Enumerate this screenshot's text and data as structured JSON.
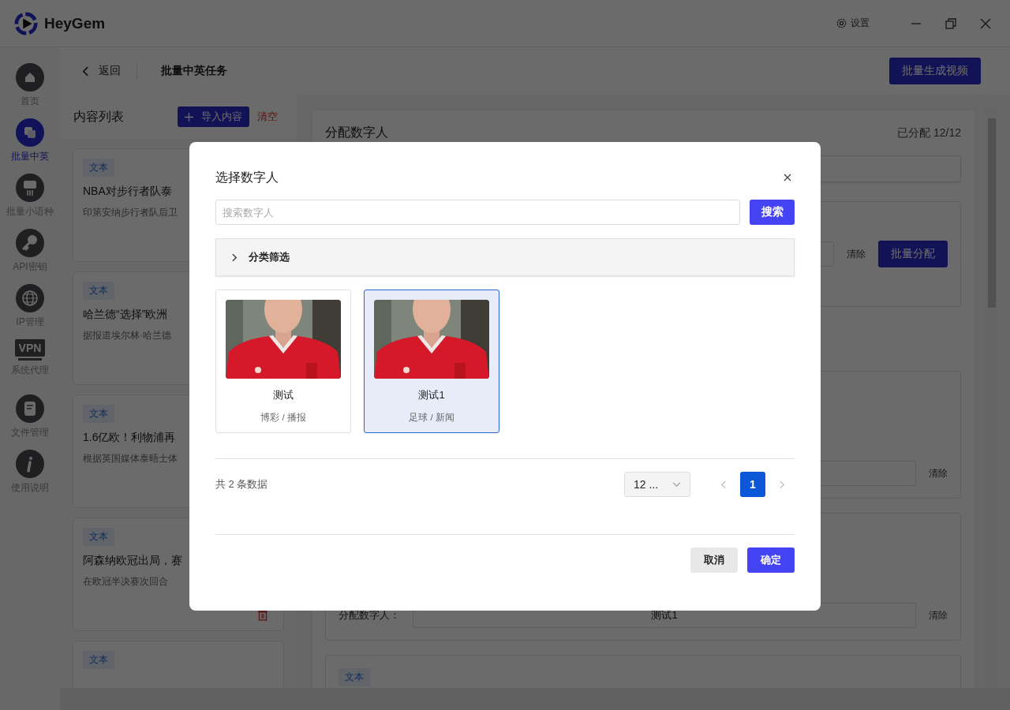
{
  "app": {
    "name": "HeyGem",
    "settings_label": "设置"
  },
  "sidebar": [
    {
      "label": "首页",
      "kind": "home",
      "selected": false
    },
    {
      "label": "批量中英",
      "kind": "layers",
      "selected": true
    },
    {
      "label": "批量小语种",
      "kind": "board",
      "selected": false
    },
    {
      "label": "API密钥",
      "kind": "key",
      "selected": false
    },
    {
      "label": "IP管理",
      "kind": "globe",
      "selected": false
    },
    {
      "label": "系统代理",
      "kind": "vpn",
      "badge": "VPN",
      "selected": false
    },
    {
      "label": "文件管理",
      "kind": "file",
      "selected": false
    },
    {
      "label": "使用说明",
      "kind": "info",
      "selected": false
    }
  ],
  "header": {
    "back": "返回",
    "title": "批量中英任务",
    "generate_button": "批量生成视频"
  },
  "content_list": {
    "title": "内容列表",
    "import_button": "导入内容",
    "clear_button": "清空",
    "items": [
      {
        "tag": "文本",
        "title": "NBA对步行者队泰",
        "summary": "印第安纳步行者队后卫"
      },
      {
        "tag": "文本",
        "title": "哈兰德“选择”欧洲",
        "summary": "据报道埃尔林·哈兰德"
      },
      {
        "tag": "文本",
        "title": "1.6亿欧！利物浦再",
        "summary": "根据英国媒体泰晤士体"
      },
      {
        "tag": "文本",
        "title": "阿森纳欧冠出局，赛",
        "summary": "在欧冠半决赛次回合",
        "delete_icon": true
      },
      {
        "tag": "文本"
      }
    ]
  },
  "assign_panel": {
    "title": "分配数字人",
    "progress": "已分配 12/12",
    "batch_clear": "清除",
    "batch_button": "批量分配",
    "rows": [
      {
        "clear": "清除"
      },
      {
        "label": "分配数字人：",
        "value": "测试1",
        "clear": "清除"
      }
    ],
    "next_tag": "文本"
  },
  "dialog": {
    "title": "选择数字人",
    "search_placeholder": "搜索数字人",
    "search_button": "搜索",
    "filter_label": "分类筛选",
    "avatars": [
      {
        "name": "测试",
        "tags": "博彩 / 播报",
        "selected": false
      },
      {
        "name": "测试1",
        "tags": "足球 / 新闻",
        "selected": true
      }
    ],
    "total": "共 2 条数据",
    "page_size": "12 ...",
    "pages": [
      {
        "label": "1",
        "selected": true
      }
    ],
    "cancel": "取消",
    "confirm": "确定"
  }
}
